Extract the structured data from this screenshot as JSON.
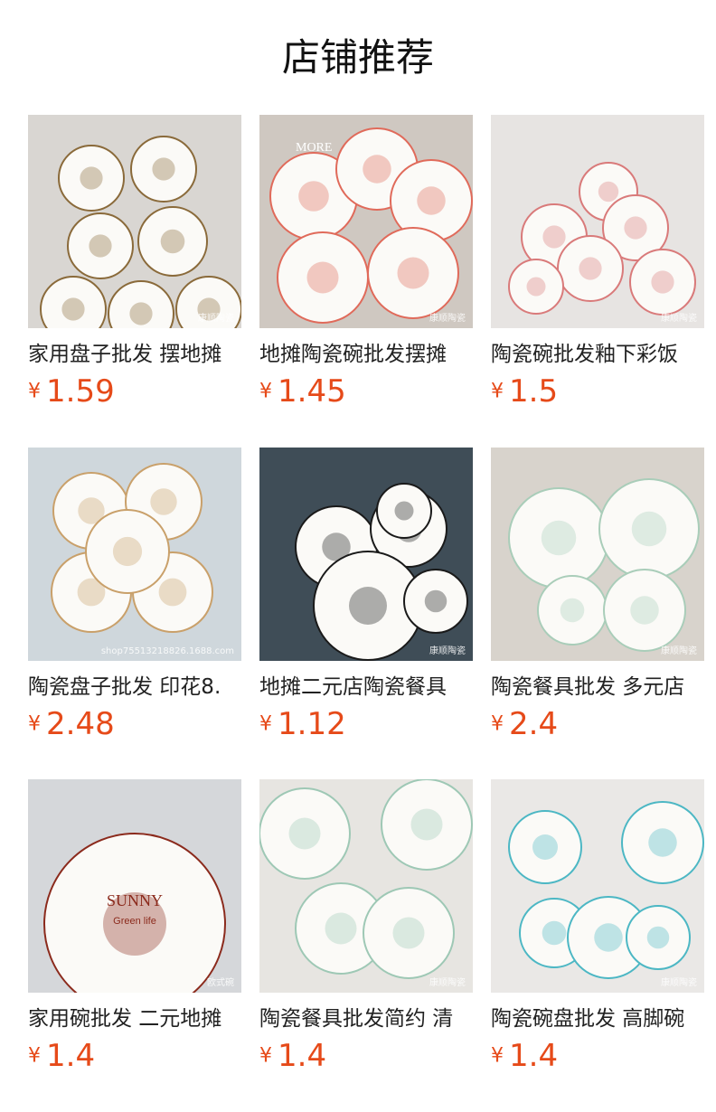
{
  "section": {
    "title": "店铺推荐"
  },
  "products": [
    {
      "name": "家用盘子批发 摆地摊",
      "currency": "¥",
      "price": "1.59",
      "watermark": "康顺陶瓷",
      "bg": "#d9d6d2",
      "accent": "#8a6a3a"
    },
    {
      "name": "地摊陶瓷碗批发摆摊",
      "currency": "¥",
      "price": "1.45",
      "watermark": "康顺陶瓷",
      "image_text": "MORE",
      "bg": "#cfc8c1",
      "accent": "#e06a5a"
    },
    {
      "name": "陶瓷碗批发釉下彩饭",
      "currency": "¥",
      "price": "1.5",
      "watermark": "康顺陶瓷",
      "bg": "#e7e4e2",
      "accent": "#d97a7a"
    },
    {
      "name": "陶瓷盘子批发 印花8.",
      "currency": "¥",
      "price": "2.48",
      "watermark": "shop75513218826.1688.com",
      "bg": "#cfd7dc",
      "accent": "#c9a06a"
    },
    {
      "name": "地摊二元店陶瓷餐具",
      "currency": "¥",
      "price": "1.12",
      "watermark": "康顺陶瓷",
      "bg": "#3f4d57",
      "accent": "#1a1a1a"
    },
    {
      "name": "陶瓷餐具批发 多元店",
      "currency": "¥",
      "price": "2.4",
      "watermark": "康顺陶瓷",
      "bg": "#d8d3cc",
      "accent": "#a9cdb9"
    },
    {
      "name": "家用碗批发 二元地摊",
      "currency": "¥",
      "price": "1.4",
      "watermark": "欧式碗",
      "image_text": "SUNNY",
      "image_subtext": "Green life",
      "bg": "#d5d7da",
      "accent": "#8b2a1c"
    },
    {
      "name": "陶瓷餐具批发简约 清",
      "currency": "¥",
      "price": "1.4",
      "watermark": "康顺陶瓷",
      "bg": "#e7e5e1",
      "accent": "#9ec8b5"
    },
    {
      "name": "陶瓷碗盘批发 高脚碗",
      "currency": "¥",
      "price": "1.4",
      "watermark": "康顺陶瓷",
      "bg": "#eae8e6",
      "accent": "#4cb7c4"
    }
  ]
}
